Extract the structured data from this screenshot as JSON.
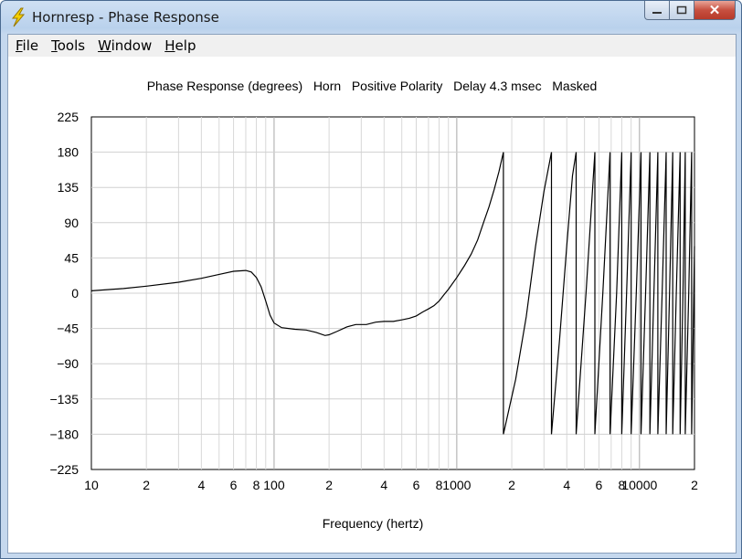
{
  "window": {
    "title": "Hornresp - Phase Response",
    "close_glyph": "✕"
  },
  "menu": [
    {
      "label": "File"
    },
    {
      "label": "Tools"
    },
    {
      "label": "Window"
    },
    {
      "label": "Help"
    }
  ],
  "colors": {
    "titlebar": "#c5d8ee",
    "close": "#c75040",
    "curve": "#000000",
    "grid": "#c8c8c8"
  },
  "chart_data": {
    "type": "line",
    "title": "Phase Response (degrees)   Horn   Positive Polarity   Delay 4.3 msec   Masked",
    "xlabel": "Frequency (hertz)",
    "ylabel": "",
    "x_scale": "log",
    "xlim": [
      10,
      20000
    ],
    "ylim": [
      -225,
      225
    ],
    "x_ticks": [
      {
        "v": 10,
        "t": "10"
      },
      {
        "v": 20,
        "t": "2"
      },
      {
        "v": 40,
        "t": "4"
      },
      {
        "v": 60,
        "t": "6"
      },
      {
        "v": 80,
        "t": "8"
      },
      {
        "v": 100,
        "t": "100"
      },
      {
        "v": 200,
        "t": "2"
      },
      {
        "v": 400,
        "t": "4"
      },
      {
        "v": 600,
        "t": "6"
      },
      {
        "v": 800,
        "t": "8"
      },
      {
        "v": 1000,
        "t": "1000"
      },
      {
        "v": 2000,
        "t": "2"
      },
      {
        "v": 4000,
        "t": "4"
      },
      {
        "v": 6000,
        "t": "6"
      },
      {
        "v": 8000,
        "t": "8"
      },
      {
        "v": 10000,
        "t": "10000"
      },
      {
        "v": 20000,
        "t": "2"
      }
    ],
    "y_ticks": [
      225,
      180,
      135,
      90,
      45,
      0,
      -45,
      -90,
      -135,
      -180,
      -225
    ],
    "grid": true,
    "series": [
      {
        "points": [
          [
            10,
            3
          ],
          [
            15,
            6
          ],
          [
            20,
            9
          ],
          [
            30,
            14
          ],
          [
            40,
            19
          ],
          [
            50,
            24
          ],
          [
            60,
            28
          ],
          [
            70,
            29
          ],
          [
            75,
            27
          ],
          [
            80,
            20
          ],
          [
            85,
            8
          ],
          [
            90,
            -10
          ],
          [
            95,
            -28
          ],
          [
            100,
            -38
          ],
          [
            110,
            -44
          ],
          [
            130,
            -46
          ],
          [
            150,
            -47
          ],
          [
            170,
            -50
          ],
          [
            190,
            -54
          ],
          [
            200,
            -53
          ],
          [
            220,
            -49
          ],
          [
            250,
            -43
          ],
          [
            280,
            -40
          ],
          [
            320,
            -40
          ],
          [
            360,
            -37
          ],
          [
            400,
            -36
          ],
          [
            450,
            -36
          ],
          [
            500,
            -34
          ],
          [
            550,
            -32
          ],
          [
            600,
            -29
          ],
          [
            650,
            -24
          ],
          [
            700,
            -20
          ],
          [
            750,
            -16
          ],
          [
            800,
            -10
          ],
          [
            850,
            -2
          ],
          [
            900,
            5
          ],
          [
            1000,
            20
          ],
          [
            1100,
            35
          ],
          [
            1200,
            50
          ],
          [
            1300,
            68
          ],
          [
            1400,
            90
          ],
          [
            1500,
            110
          ],
          [
            1600,
            132
          ],
          [
            1700,
            155
          ],
          [
            1800,
            180
          ],
          [
            1800,
            -180
          ],
          [
            2100,
            -110
          ],
          [
            2400,
            -30
          ],
          [
            2700,
            60
          ],
          [
            3000,
            130
          ],
          [
            3300,
            180
          ],
          [
            3300,
            -180
          ],
          [
            3650,
            -60
          ],
          [
            4000,
            60
          ],
          [
            4300,
            150
          ],
          [
            4500,
            180
          ],
          [
            4500,
            -180
          ],
          [
            5100,
            0
          ],
          [
            5700,
            180
          ],
          [
            5700,
            -180
          ],
          [
            6300,
            0
          ],
          [
            6900,
            180
          ],
          [
            6900,
            -180
          ],
          [
            7500,
            0
          ],
          [
            8000,
            180
          ],
          [
            8000,
            -180
          ],
          [
            8500,
            0
          ],
          [
            9000,
            180
          ],
          [
            9000,
            -180
          ],
          [
            9600,
            0
          ],
          [
            10200,
            180
          ],
          [
            10200,
            -180
          ],
          [
            10800,
            0
          ],
          [
            11400,
            180
          ],
          [
            11400,
            -180
          ],
          [
            12000,
            0
          ],
          [
            12600,
            180
          ],
          [
            12600,
            -180
          ],
          [
            13300,
            0
          ],
          [
            14000,
            180
          ],
          [
            14000,
            -180
          ],
          [
            14600,
            0
          ],
          [
            15200,
            180
          ],
          [
            15200,
            -180
          ],
          [
            15900,
            0
          ],
          [
            16700,
            180
          ],
          [
            16700,
            -180
          ],
          [
            17300,
            0
          ],
          [
            17800,
            180
          ],
          [
            17800,
            -180
          ],
          [
            18600,
            0
          ],
          [
            19300,
            180
          ],
          [
            19300,
            -180
          ],
          [
            19700,
            -45
          ],
          [
            20000,
            60
          ]
        ]
      }
    ]
  }
}
